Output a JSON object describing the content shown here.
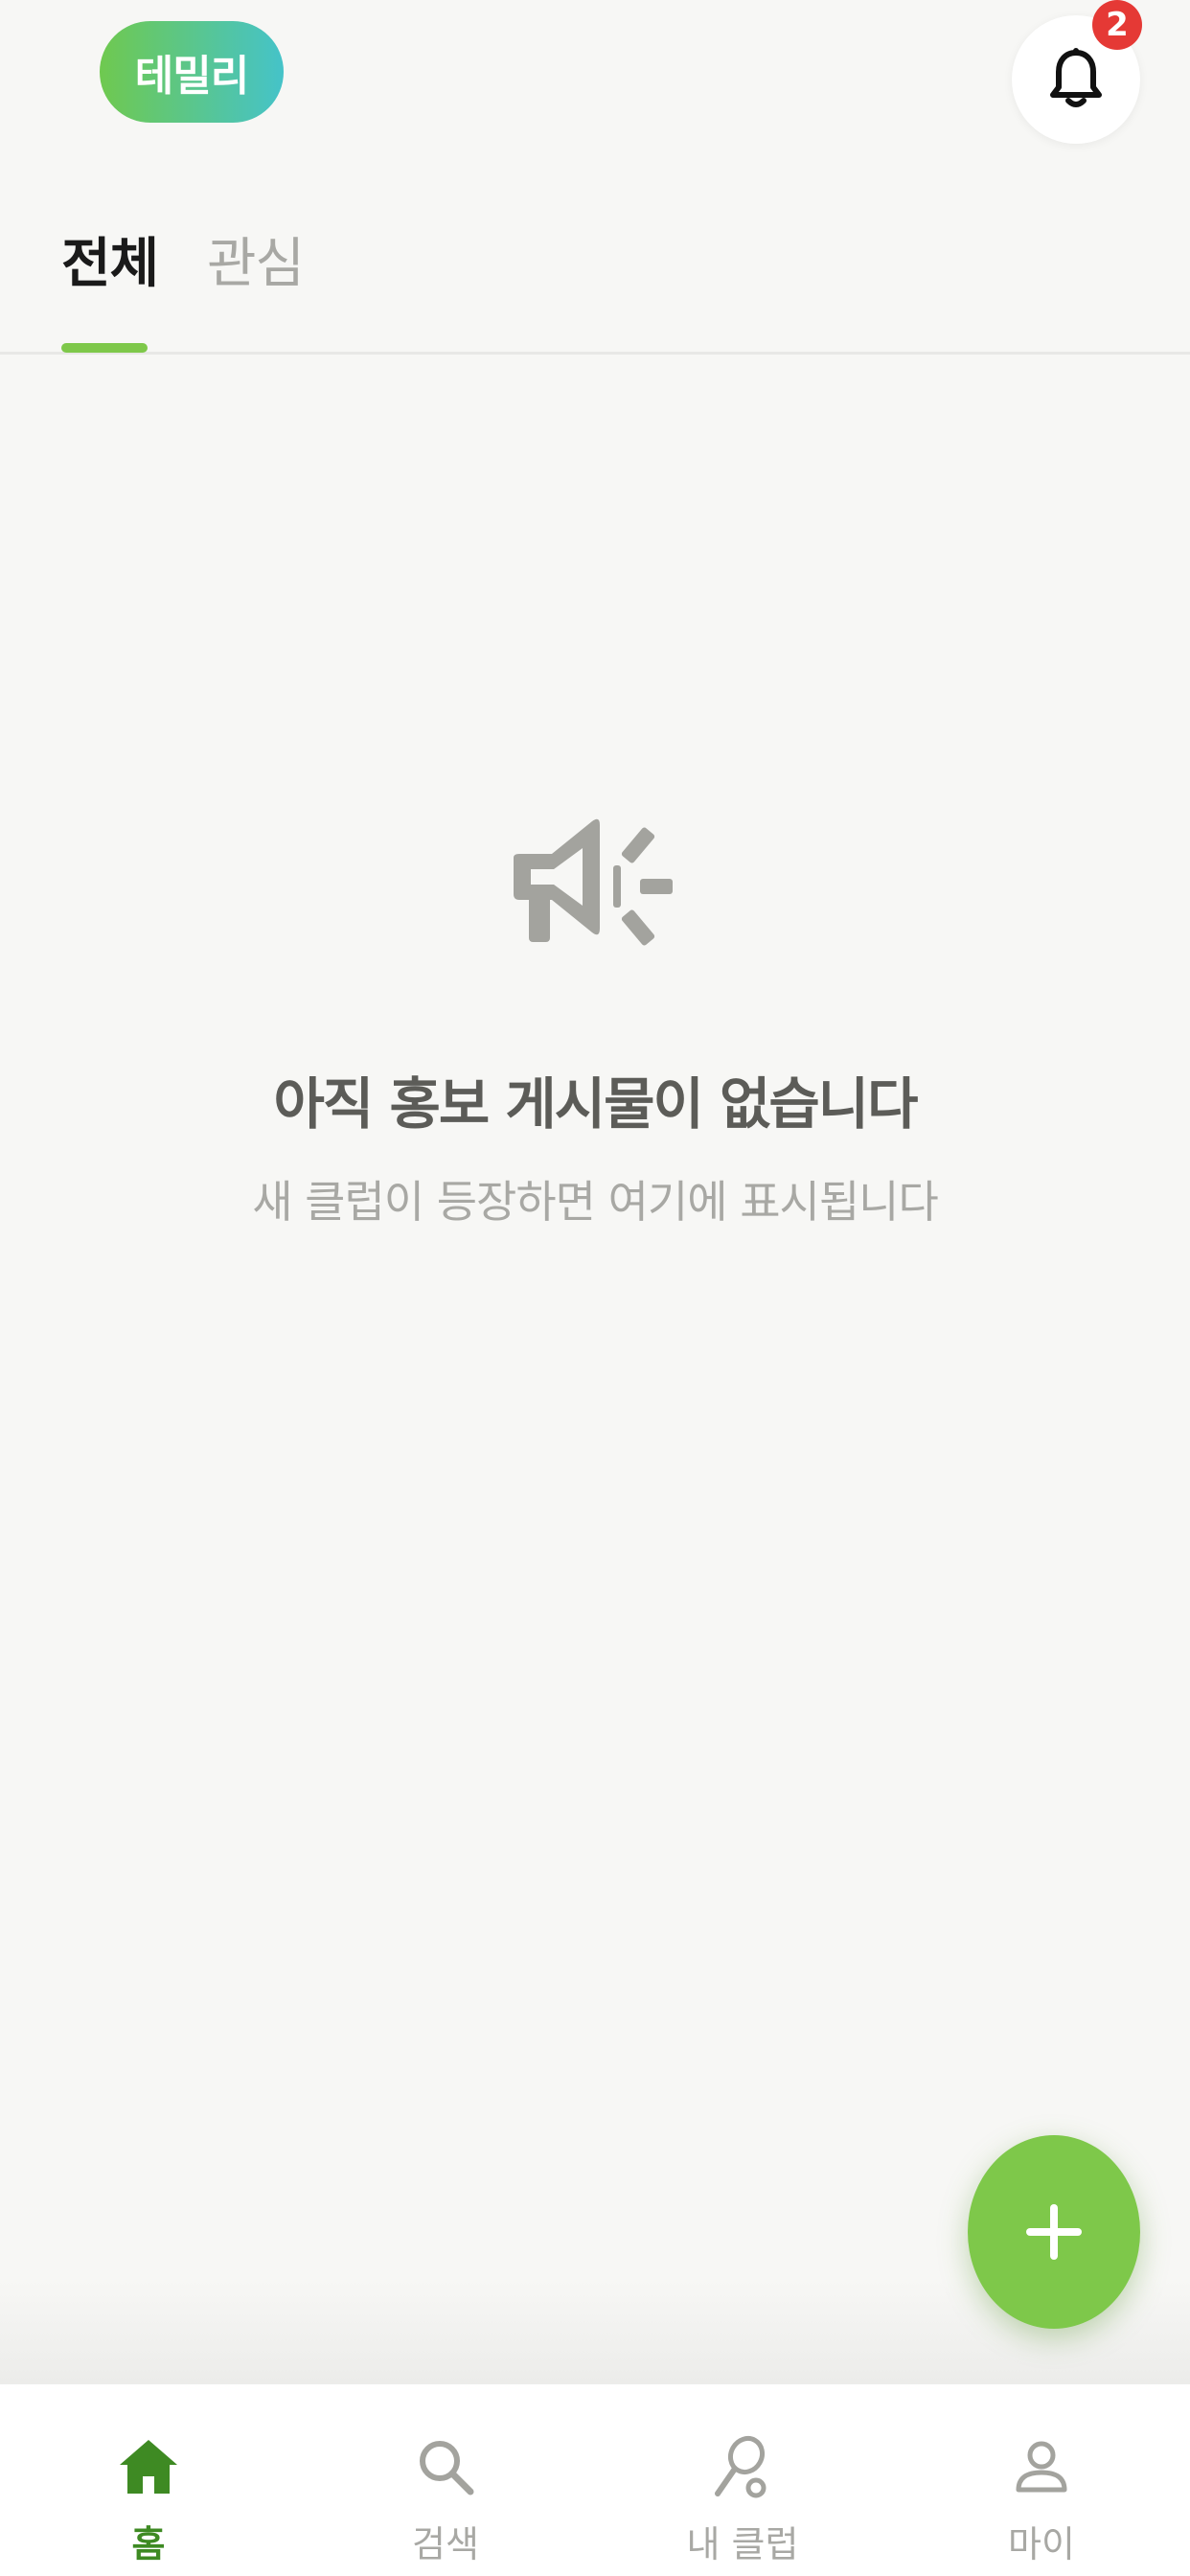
{
  "header": {
    "brand_label": "테밀리",
    "notification_count": "2"
  },
  "tabs": [
    {
      "label": "전체",
      "active": true
    },
    {
      "label": "관심",
      "active": false
    }
  ],
  "empty_state": {
    "icon": "megaphone-icon",
    "title": "아직 홍보 게시물이 없습니다",
    "subtitle": "새 클럽이 등장하면 여기에 표시됩니다"
  },
  "fab": {
    "icon": "plus-icon"
  },
  "bottom_nav": [
    {
      "label": "홈",
      "icon": "home-icon",
      "active": true
    },
    {
      "label": "검색",
      "icon": "search-icon",
      "active": false
    },
    {
      "label": "내 클럽",
      "icon": "racket-icon",
      "active": false
    },
    {
      "label": "마이",
      "icon": "person-icon",
      "active": false
    }
  ],
  "colors": {
    "accent_green": "#7ec84a",
    "active_nav_green": "#3e8a23",
    "badge_red": "#e53935",
    "brand_gradient_start": "#6fc94f",
    "brand_gradient_end": "#45c3c9",
    "background": "#f7f7f5"
  }
}
